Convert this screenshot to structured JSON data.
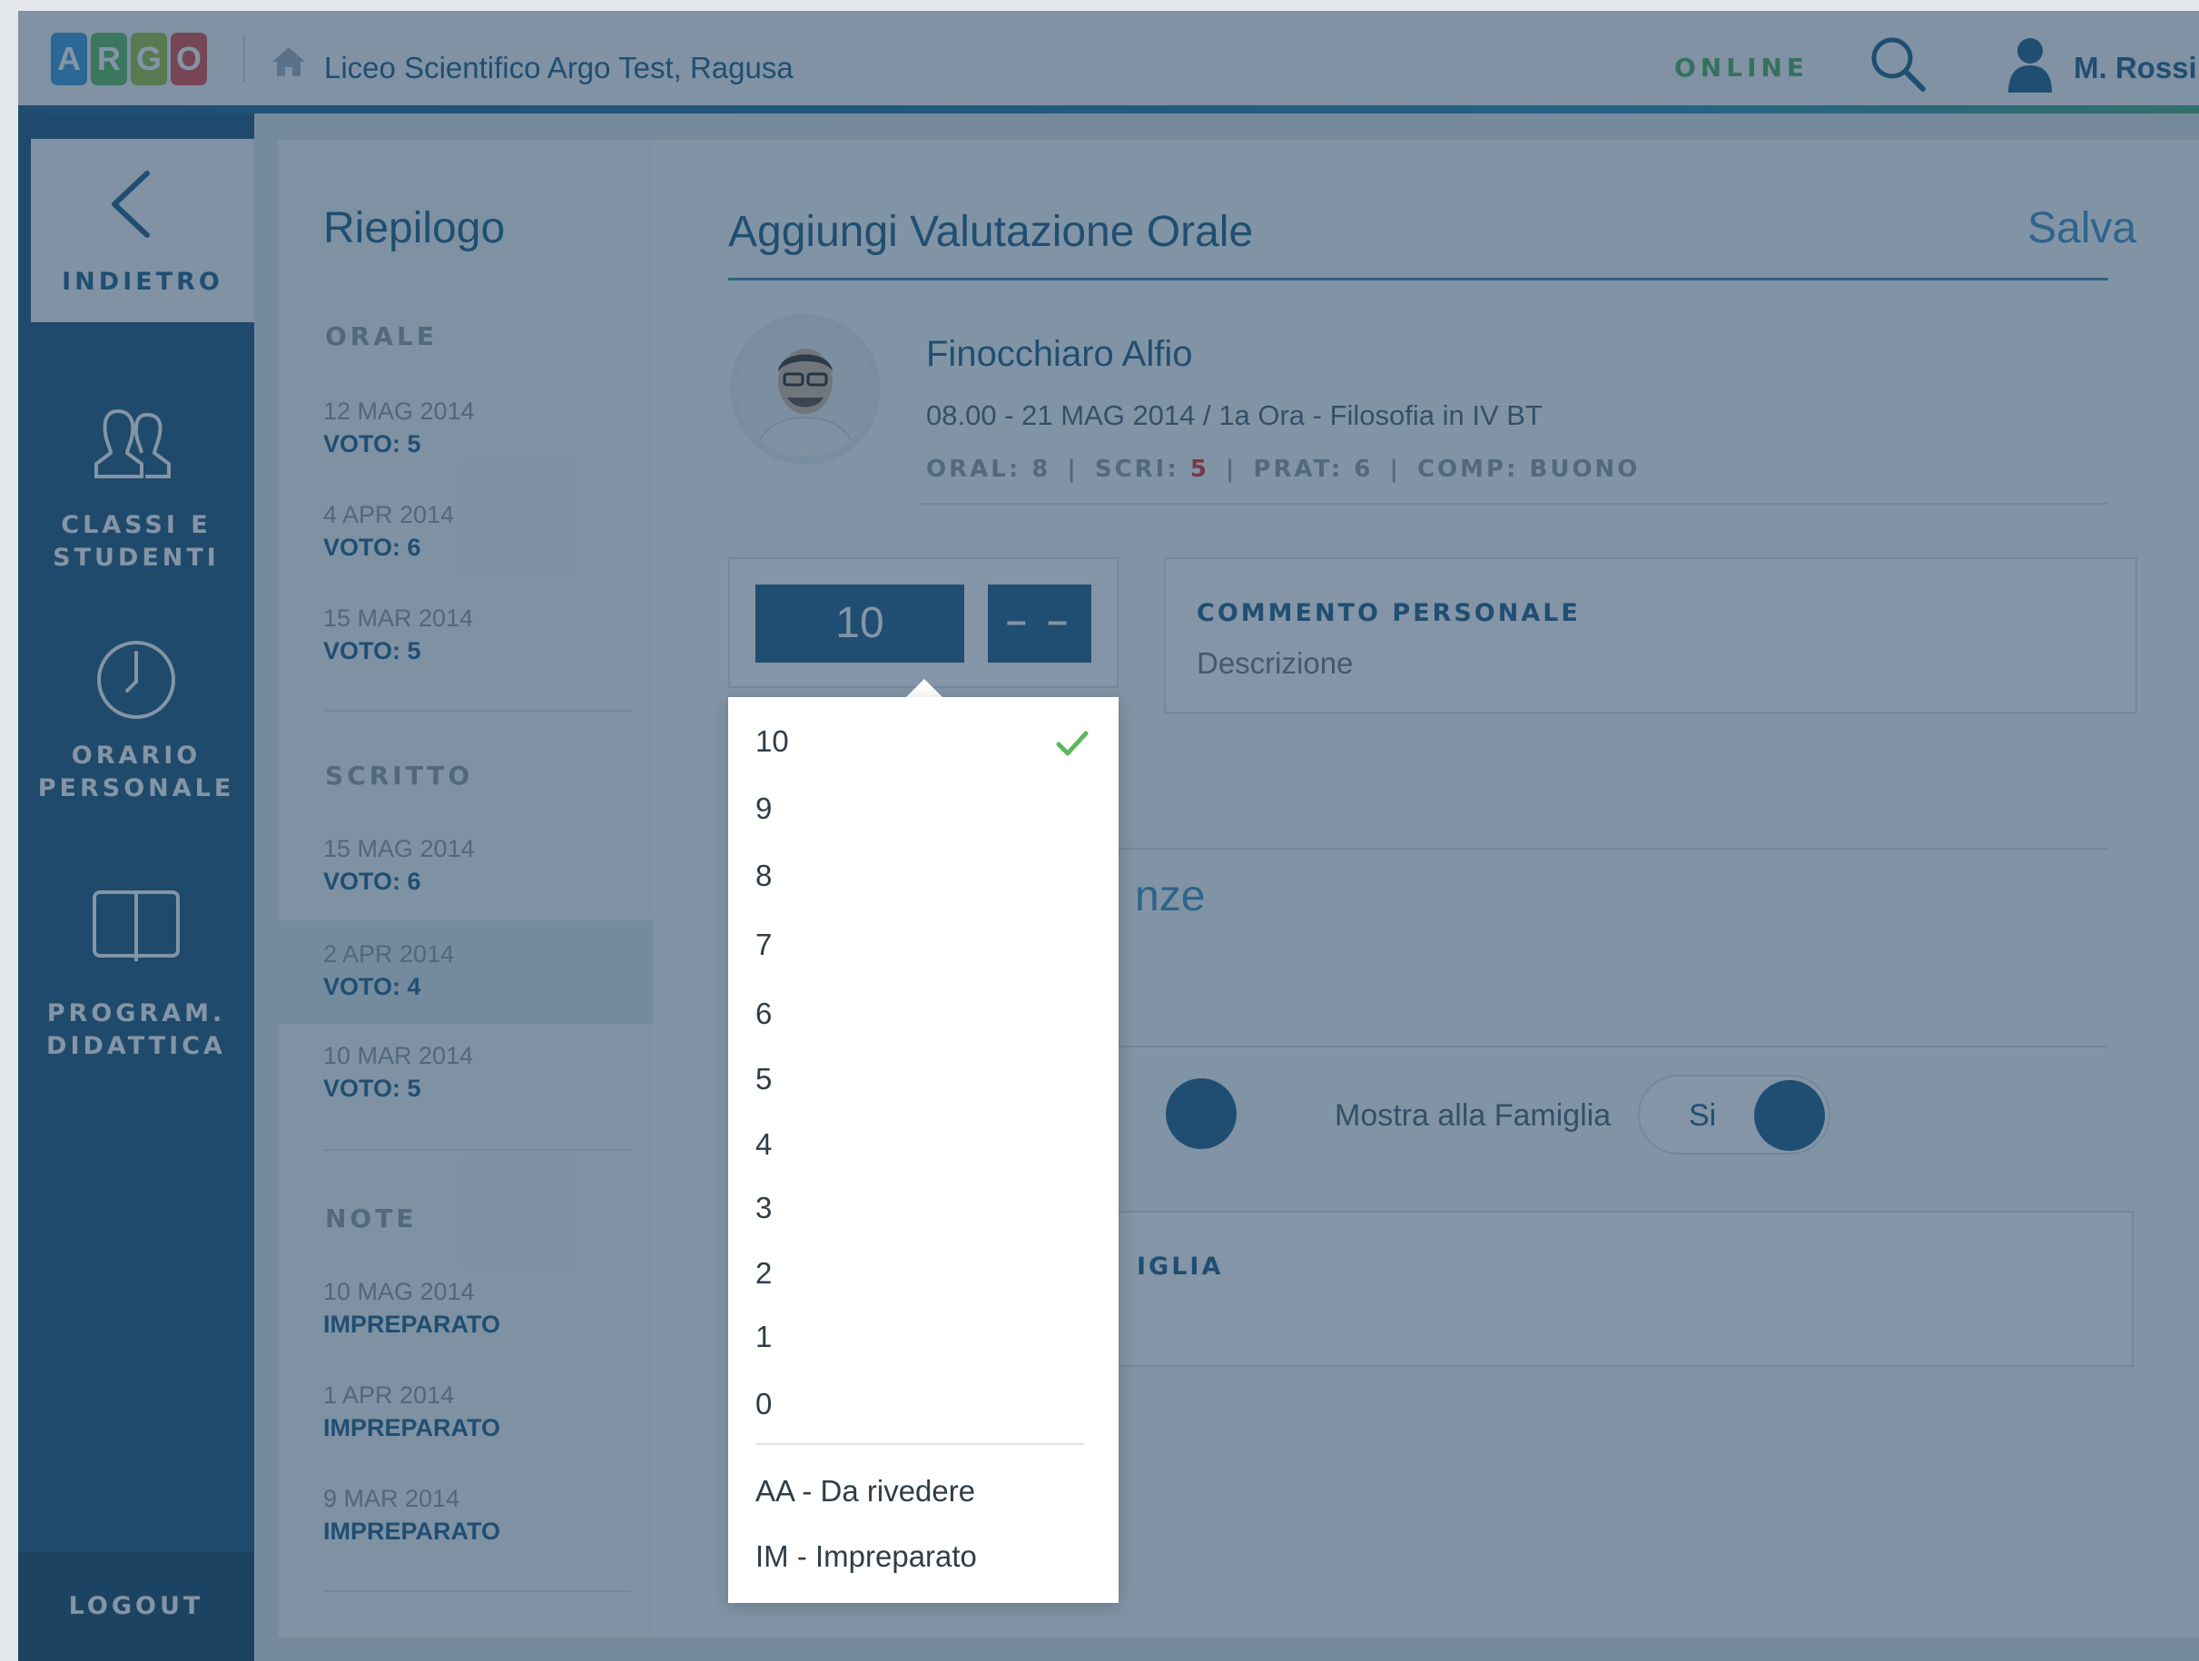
{
  "topbar": {
    "logo_letters": [
      "A",
      "R",
      "G",
      "O"
    ],
    "logo_colors": [
      "#3a9ad9",
      "#5cb85c",
      "#9cc23b",
      "#e24b4b"
    ],
    "school": "Liceo Scientifico Argo Test, Ragusa",
    "status": "ONLINE",
    "user": "M. Rossi",
    "icons": [
      "home-icon",
      "search-icon",
      "user-icon"
    ]
  },
  "sidebar": {
    "back": "INDIETRO",
    "items": [
      {
        "line1": "CLASSI E",
        "line2": "STUDENTI",
        "icon": "students-icon"
      },
      {
        "line1": "ORARIO",
        "line2": "PERSONALE",
        "icon": "clock-icon"
      },
      {
        "line1": "PROGRAM.",
        "line2": "DIDATTICA",
        "icon": "book-icon"
      }
    ],
    "logout": "LOGOUT"
  },
  "summary": {
    "title": "Riepilogo",
    "sections": [
      {
        "heading": "ORALE",
        "entries": [
          {
            "date": "12 MAG 2014",
            "value": "VOTO: 5"
          },
          {
            "date": "4 APR 2014",
            "value": "VOTO: 6"
          },
          {
            "date": "15 MAR 2014",
            "value": "VOTO: 5"
          }
        ]
      },
      {
        "heading": "SCRITTO",
        "entries": [
          {
            "date": "15 MAG 2014",
            "value": "VOTO: 6"
          },
          {
            "date": "2 APR 2014",
            "value": "VOTO: 4"
          },
          {
            "date": "10 MAR 2014",
            "value": "VOTO: 5"
          }
        ]
      },
      {
        "heading": "NOTE",
        "entries": [
          {
            "date": "10 MAG 2014",
            "value": "IMPREPARATO"
          },
          {
            "date": "1 APR 2014",
            "value": "IMPREPARATO"
          },
          {
            "date": "9 MAR 2014",
            "value": "IMPREPARATO"
          }
        ]
      }
    ]
  },
  "main": {
    "title": "Aggiungi Valutazione Orale",
    "save": "Salva",
    "student": {
      "name": "Finocchiaro Alfio",
      "lesson": "08.00 - 21 MAG 2014 / 1a Ora - Filosofia in IV BT",
      "grades": {
        "oral": "ORAL: 8",
        "scri_label": "SCRI: ",
        "scri_value": "5",
        "prat": "PRAT: 6",
        "comp": "COMP: BUONO",
        "separator": "|"
      }
    },
    "grade_button": "10",
    "modifier_button": "– –",
    "comment": {
      "label": "COMMENTO PERSONALE",
      "placeholder": "Descrizione"
    },
    "partial_heading": "nze",
    "family_toggle": {
      "label": "Mostra alla Famiglia",
      "value": "Si"
    },
    "family_comment_partial": "IGLIA"
  },
  "dropdown": {
    "selected": "10",
    "options": [
      "10",
      "9",
      "8",
      "7",
      "6",
      "5",
      "4",
      "3",
      "2",
      "1",
      "0"
    ],
    "extra_options": [
      "AA - Da rivedere",
      "IM - Impreparato"
    ]
  }
}
